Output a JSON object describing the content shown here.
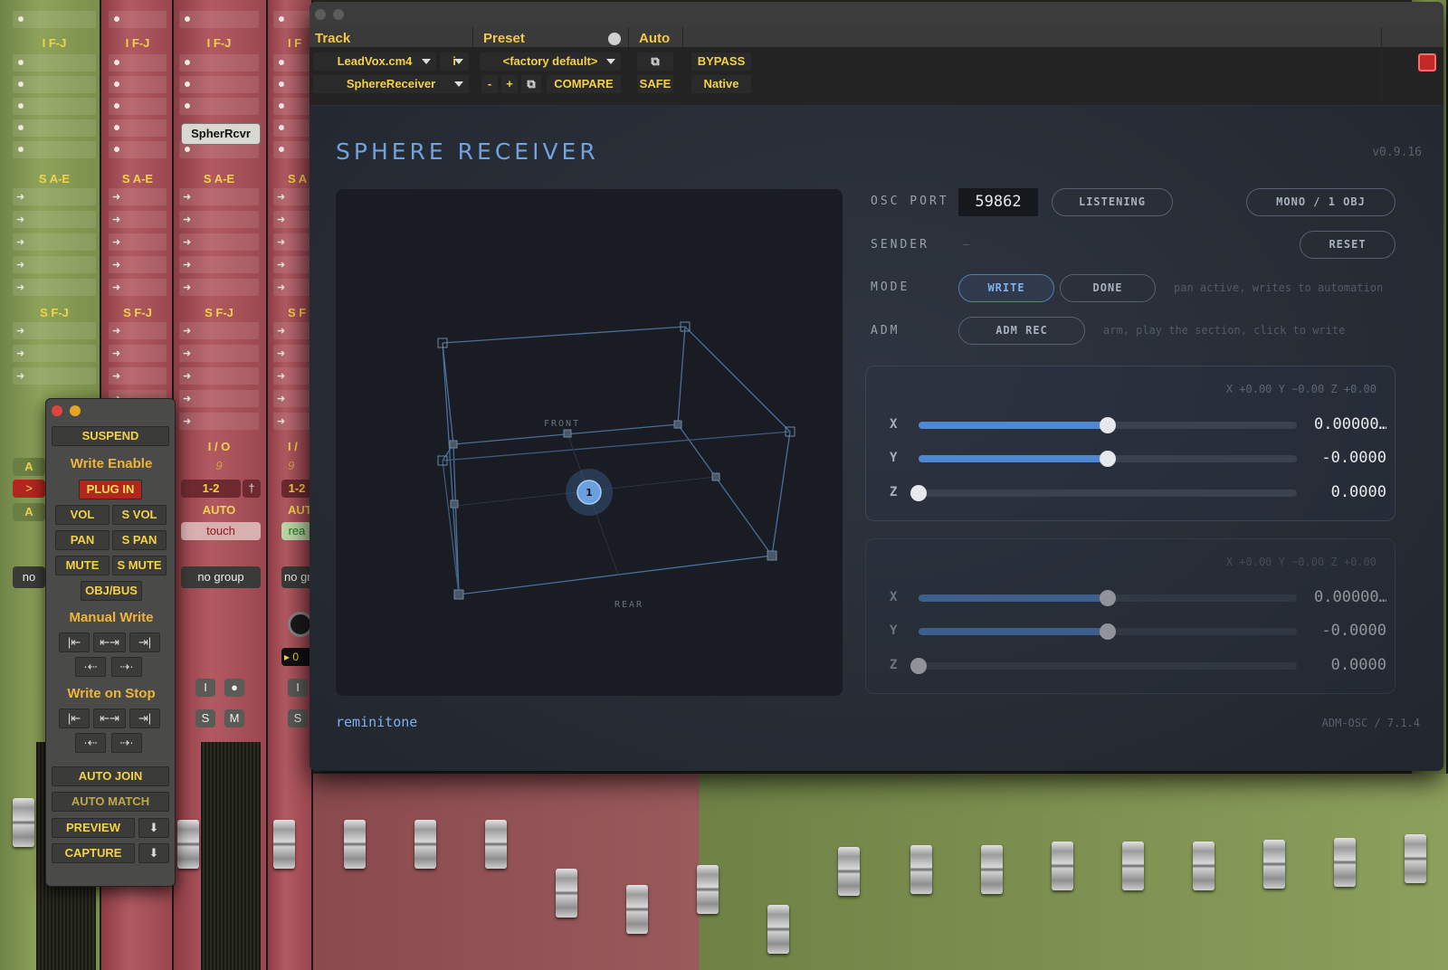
{
  "mixer": {
    "insert_label_ifj": "I F-J",
    "insert_label_sae": "S A-E",
    "insert_label_sfj": "S F-J",
    "spher_insert": "SpherRcvr",
    "io_label": "I / O",
    "io_value": "1-2",
    "io_num": "9",
    "auto_label": "AUTO",
    "auto_mode": "touch",
    "group_label": "no group",
    "solo_btn": "S",
    "mute_btn": "M",
    "input_btn": "I",
    "partial_labels": {
      "io": "I /",
      "io_value": "1-2",
      "io_num": "9",
      "auto": "AUT",
      "auto_mode": "rea",
      "group": "no gr",
      "sae": "S A",
      "sfj": "S F",
      "ifj": "I F",
      "left_group": "no",
      "left_chan": ">",
      "left_a1": "A",
      "left_a2": "A",
      "left_counter": "0"
    }
  },
  "autowin": {
    "suspend": "SUSPEND",
    "write_enable": "Write Enable",
    "plug_in": "PLUG IN",
    "vol": "VOL",
    "s_vol": "S VOL",
    "pan": "PAN",
    "s_pan": "S PAN",
    "mute": "MUTE",
    "s_mute": "S MUTE",
    "obj_bus": "OBJ/BUS",
    "manual_write": "Manual Write",
    "write_on_stop": "Write on Stop",
    "auto_join": "AUTO JOIN",
    "auto_match": "AUTO MATCH",
    "preview": "PREVIEW",
    "capture": "CAPTURE"
  },
  "header": {
    "track_label": "Track",
    "preset_label": "Preset",
    "auto_label": "Auto",
    "track_name": "LeadVox.cm4",
    "track_io": "i",
    "plugin_name": "SphereReceiver",
    "preset_name": "<factory default>",
    "minus": "-",
    "plus": "+",
    "compare": "COMPARE",
    "bypass": "BYPASS",
    "safe": "SAFE",
    "native": "Native"
  },
  "plugin": {
    "title": "SPHERE RECEIVER",
    "version": "v0.9.16",
    "view": {
      "front_label": "FRONT",
      "rear_label": "REAR",
      "object_number": "1"
    },
    "osc_port_label": "OSC PORT",
    "osc_port": "59862",
    "listening": "LISTENING",
    "mono_obj": "MONO / 1 OBJ",
    "sender_label": "SENDER",
    "sender_value": "—",
    "reset": "RESET",
    "mode_label": "MODE",
    "write": "WRITE",
    "done": "DONE",
    "mode_hint": "pan active, writes to automation",
    "adm_label": "ADM",
    "adm_rec": "ADM REC",
    "adm_hint": "arm, play the section, click to write",
    "panel1": {
      "coords": "X +0.00   Y −0.00   Z +0.00",
      "x_label": "X",
      "x_value": "0.00000…",
      "x_pos": 0.5,
      "y_label": "Y",
      "y_value": "-0.0000",
      "y_pos": 0.5,
      "z_label": "Z",
      "z_value": "0.0000",
      "z_pos": 0.0
    },
    "panel2": {
      "coords": "X +0.00   Y −0.00   Z +0.00",
      "x_label": "X",
      "x_value": "0.00000…",
      "x_pos": 0.5,
      "y_label": "Y",
      "y_value": "-0.0000",
      "y_pos": 0.5,
      "z_label": "Z",
      "z_value": "0.0000",
      "z_pos": 0.0
    },
    "brand": "reminitone",
    "protocol": "ADM-OSC / 7.1.4"
  },
  "colors": {
    "accent_blue": "#4f88d2",
    "label_yellow": "#f3d249",
    "plug_red": "#b3261e",
    "strip_green": "#8ea35a",
    "strip_red": "#b25a62"
  }
}
